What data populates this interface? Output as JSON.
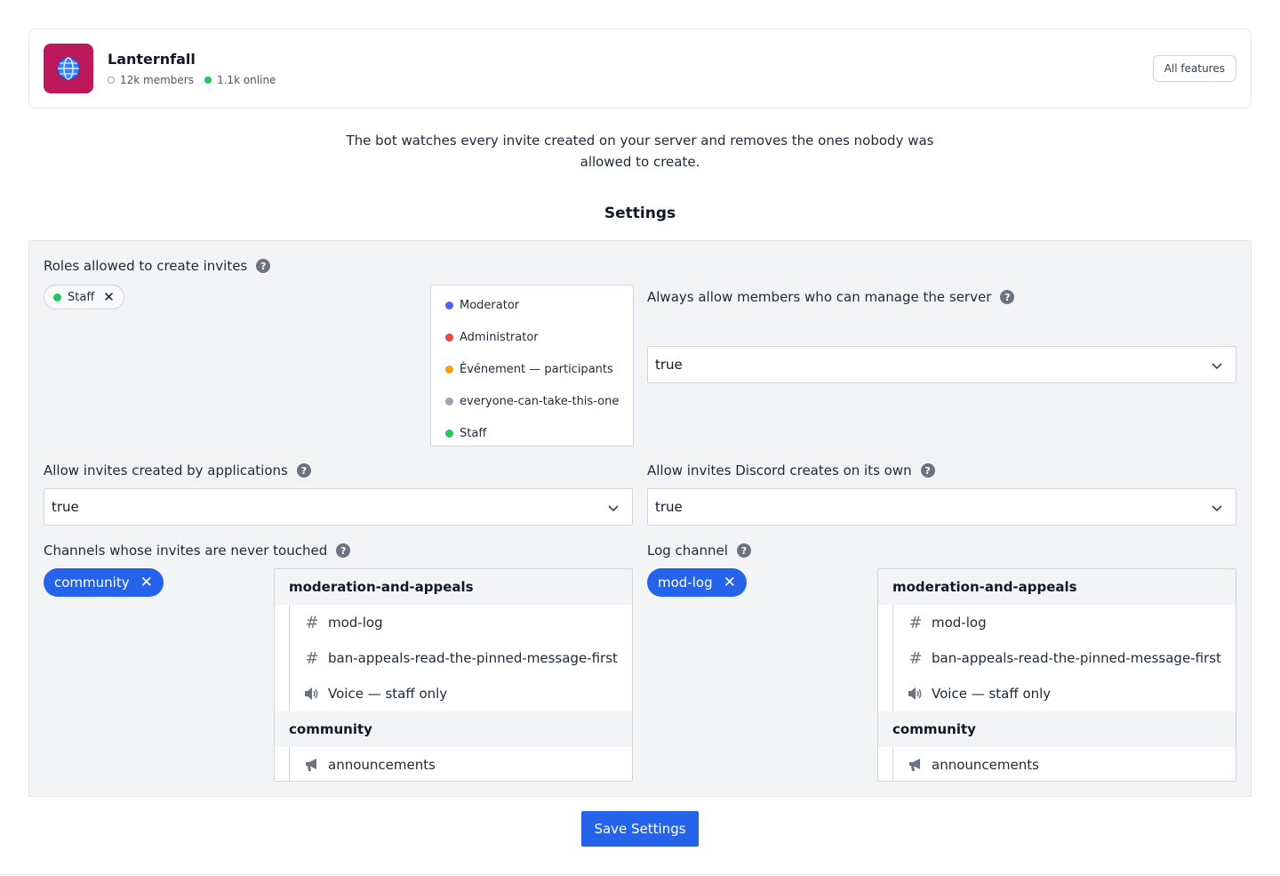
{
  "server": {
    "name": "Lanternfall",
    "icon_color": "#be185d",
    "members": "12k members",
    "online": "1.1k online",
    "online_color": "#22c55e",
    "all_features_label": "All features"
  },
  "description": "The bot watches every invite created on your server and removes the ones nobody was allowed to create.",
  "settings_title": "Settings",
  "roles": {
    "label": "Roles allowed to create invites",
    "selected": [
      {
        "name": "Staff",
        "color": "#22c55e"
      }
    ],
    "options": [
      {
        "name": "Moderator",
        "color": "#4f63e7"
      },
      {
        "name": "Administrator",
        "color": "#ef4444"
      },
      {
        "name": "Événement — participants",
        "color": "#f59e0b"
      },
      {
        "name": "everyone-can-take-this-one",
        "color": "#9ca3af"
      },
      {
        "name": "Staff",
        "color": "#22c55e"
      }
    ]
  },
  "manage_server": {
    "label": "Always allow members who can manage the server",
    "value": "true"
  },
  "applications": {
    "label": "Allow invites created by applications",
    "value": "true"
  },
  "discord_own": {
    "label": "Allow invites Discord creates on its own",
    "value": "true"
  },
  "untouched_channels": {
    "label": "Channels whose invites are never touched",
    "selected": "community"
  },
  "log_channel": {
    "label": "Log channel",
    "selected": "mod-log"
  },
  "channel_tree": {
    "categories": [
      {
        "name": "moderation-and-appeals",
        "channels": [
          {
            "name": "mod-log",
            "icon": "hash-icon"
          },
          {
            "name": "ban-appeals-read-the-pinned-message-first",
            "icon": "hash-icon"
          },
          {
            "name": "Voice — staff only",
            "icon": "speaker-icon"
          }
        ]
      },
      {
        "name": "community",
        "channels": [
          {
            "name": "announcements",
            "icon": "megaphone-icon"
          }
        ]
      }
    ]
  },
  "save_label": "Save Settings",
  "accent_color": "#2563eb"
}
